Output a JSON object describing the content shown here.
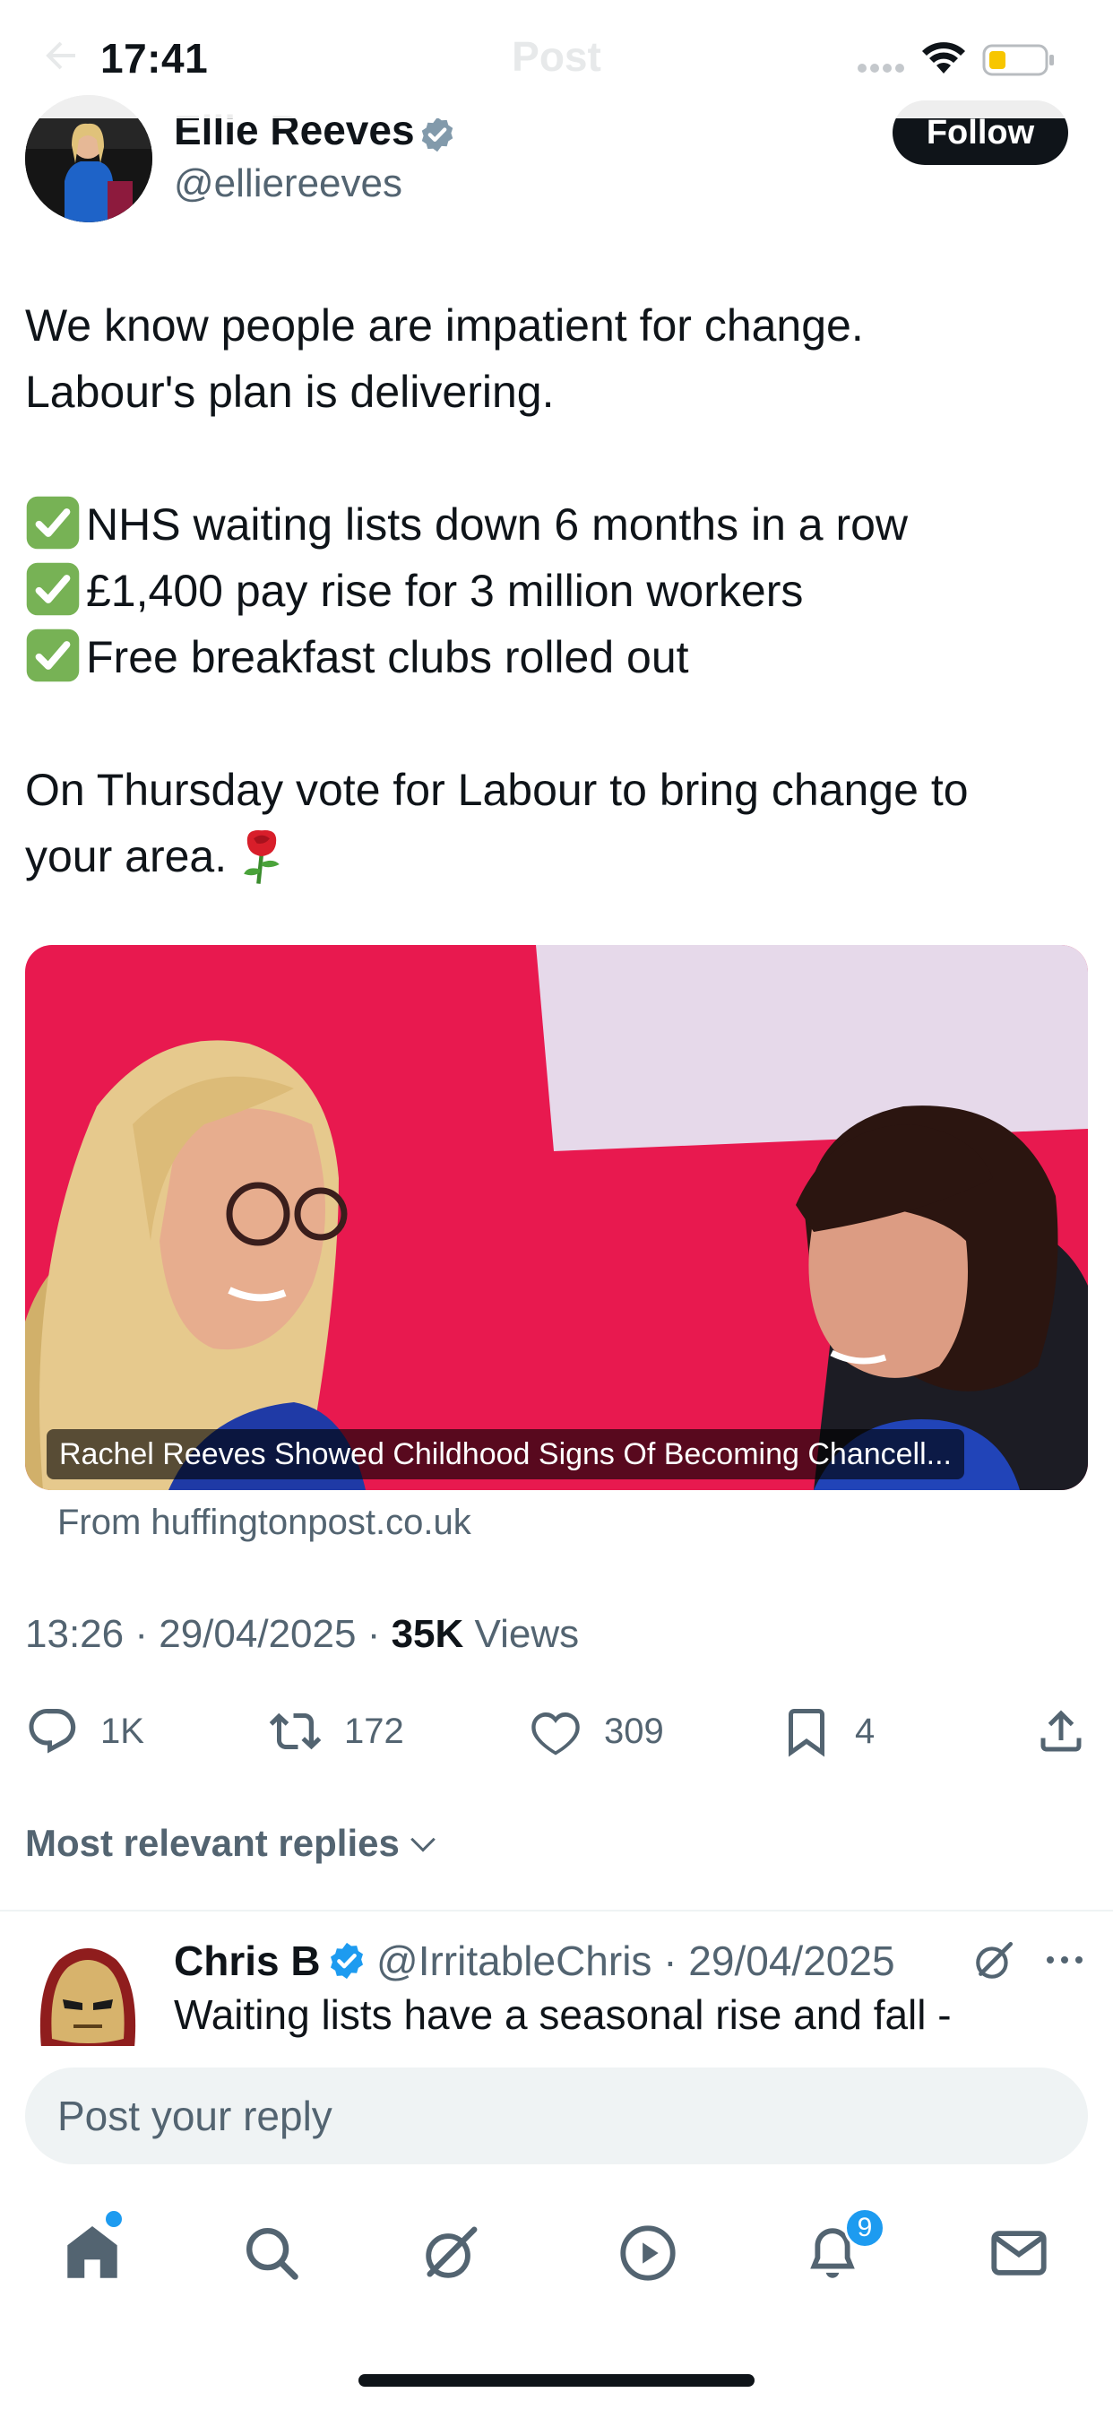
{
  "status_bar": {
    "time": "17:41"
  },
  "header": {
    "title": "Post"
  },
  "author": {
    "name": "Ellie Reeves",
    "handle": "@elliereeves",
    "follow_label": "Follow"
  },
  "post": {
    "line1": "We know people are impatient for change.",
    "line2": "Labour's plan is delivering.",
    "bullets": [
      "NHS waiting lists down 6 months in a row",
      "£1,400 pay rise for 3 million workers",
      "Free breakfast clubs rolled out"
    ],
    "closing1": "On Thursday vote for Labour to bring change to",
    "closing2": "your area."
  },
  "card": {
    "caption": "Rachel Reeves Showed Childhood Signs Of Becoming Chancell...",
    "source": "From huffingtonpost.co.uk"
  },
  "meta": {
    "time": "13:26",
    "date": "29/04/2025",
    "views_count": "35K",
    "views_label": "Views"
  },
  "actions": {
    "replies": "1K",
    "reposts": "172",
    "likes": "309",
    "bookmarks": "4"
  },
  "replies_filter": "Most relevant replies",
  "reply": {
    "name": "Chris B",
    "handle_date": "@IrritableChris · 29/04/2025",
    "text": "Waiting lists have a seasonal rise and fall -"
  },
  "reply_bar": {
    "placeholder": "Post your reply"
  },
  "tab_bar": {
    "notifications_count": "9"
  },
  "colors": {
    "accent": "#1d9bf0",
    "text": "#0f1419",
    "secondary": "#536471",
    "brand_card": "#e8194f"
  }
}
